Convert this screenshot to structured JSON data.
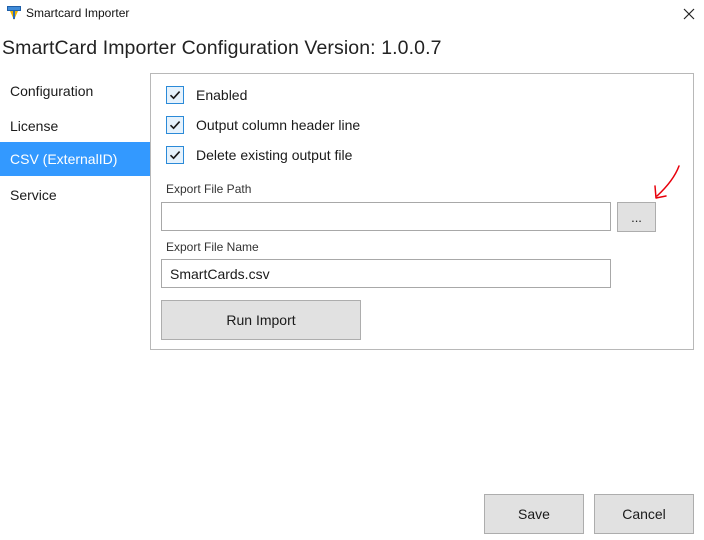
{
  "window": {
    "title": "Smartcard Importer",
    "icon": "smartcard-app-icon",
    "close_icon": "close-icon"
  },
  "header": {
    "title": "SmartCard Importer Configuration Version: 1.0.0.7"
  },
  "nav": {
    "items": [
      {
        "label": "Configuration",
        "active": false
      },
      {
        "label": "License",
        "active": false
      },
      {
        "label": "CSV (ExternalID)",
        "active": true
      },
      {
        "label": "Service",
        "active": false
      }
    ]
  },
  "panel": {
    "checkboxes": [
      {
        "label": "Enabled",
        "checked": true
      },
      {
        "label": "Output column header line",
        "checked": true
      },
      {
        "label": "Delete existing output file",
        "checked": true
      }
    ],
    "export_path": {
      "label": "Export File Path",
      "value": "",
      "browse_label": "..."
    },
    "export_name": {
      "label": "Export File Name",
      "value": "SmartCards.csv"
    },
    "run_import_label": "Run Import"
  },
  "footer": {
    "save_label": "Save",
    "cancel_label": "Cancel"
  },
  "colors": {
    "accent": "#3399ff",
    "checkbox_border": "#2b8ad8",
    "annotation": "#e8000b"
  }
}
